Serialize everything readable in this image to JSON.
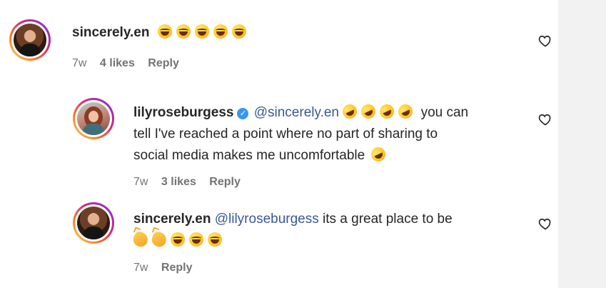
{
  "comments": [
    {
      "username": "sincerely.en",
      "mention": "",
      "text": "",
      "emojis_line": [
        "laugh",
        "laugh",
        "laugh",
        "laugh",
        "laugh"
      ],
      "time": "7w",
      "likes": "4 likes",
      "reply": "Reply"
    },
    {
      "username": "lilyroseburgess",
      "verified": true,
      "mention": "@sincerely.en",
      "emojis_inline": [
        "rofl",
        "rofl",
        "rofl",
        "rofl"
      ],
      "line1_text": "you can",
      "line2_text": "tell I've reached a point where no part of sharing to",
      "line3_text": "social media makes me uncomfortable",
      "line3_emoji": "rofl",
      "time": "7w",
      "likes": "3 likes",
      "reply": "Reply"
    },
    {
      "username": "sincerely.en",
      "mention": "@lilyroseburgess",
      "text": "its a great place to be",
      "emojis_line2": [
        "clap",
        "clap",
        "laugh",
        "laugh",
        "laugh"
      ],
      "time": "7w",
      "reply": "Reply"
    }
  ],
  "icons": {
    "heart": "heart-outline-icon",
    "verified": "verified-badge-icon"
  },
  "colors": {
    "mention": "#385898",
    "meta": "#737373",
    "verified": "#3897f0"
  }
}
